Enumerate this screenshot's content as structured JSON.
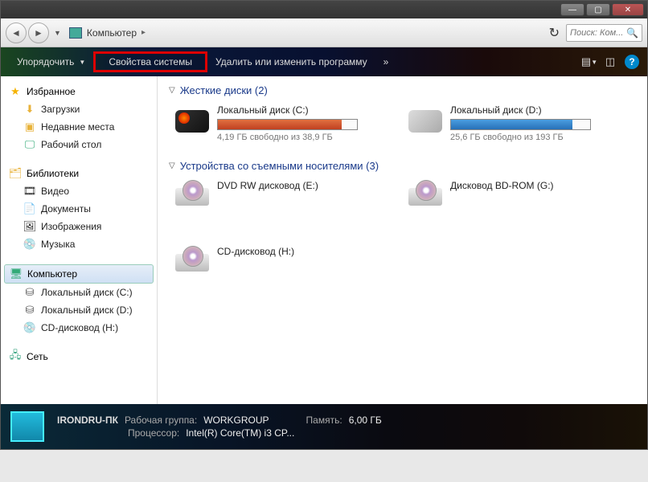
{
  "titlebar": {
    "min": "—",
    "max": "▢",
    "close": "✕"
  },
  "nav": {
    "location": "Компьютер",
    "search_placeholder": "Поиск: Ком..."
  },
  "toolbar": {
    "organize": "Упорядочить",
    "system_props": "Свойства системы",
    "uninstall": "Удалить или изменить программу",
    "overflow": "»"
  },
  "sidebar": {
    "favorites": {
      "label": "Избранное",
      "items": [
        {
          "icon": "download-icon",
          "label": "Загрузки"
        },
        {
          "icon": "recent-icon",
          "label": "Недавние места"
        },
        {
          "icon": "desktop-icon",
          "label": "Рабочий стол"
        }
      ]
    },
    "libraries": {
      "label": "Библиотеки",
      "items": [
        {
          "icon": "video-icon",
          "label": "Видео"
        },
        {
          "icon": "documents-icon",
          "label": "Документы"
        },
        {
          "icon": "pictures-icon",
          "label": "Изображения"
        },
        {
          "icon": "music-icon",
          "label": "Музыка"
        }
      ]
    },
    "computer": {
      "label": "Компьютер",
      "items": [
        {
          "icon": "disk-icon",
          "label": "Локальный диск (C:)"
        },
        {
          "icon": "disk-icon",
          "label": "Локальный диск (D:)"
        },
        {
          "icon": "cd-icon",
          "label": "CD-дисковод (H:)"
        }
      ]
    },
    "network": {
      "label": "Сеть"
    }
  },
  "content": {
    "hdd_section": "Жесткие диски (2)",
    "removable_section": "Устройства со съемными носителями (3)",
    "drives": [
      {
        "name": "Локальный диск (C:)",
        "free_text": "4,19 ГБ свободно из 38,9 ГБ",
        "fill_pct": 89,
        "warn": true
      },
      {
        "name": "Локальный диск (D:)",
        "free_text": "25,6 ГБ свободно из 193 ГБ",
        "fill_pct": 87,
        "warn": false
      }
    ],
    "removable": [
      {
        "name": "DVD RW дисковод (E:)"
      },
      {
        "name": "Дисковод BD-ROM (G:)"
      },
      {
        "name": "CD-дисковод (H:)"
      }
    ]
  },
  "status": {
    "name": "IRONDRU-ПК",
    "workgroup_label": "Рабочая группа:",
    "workgroup": "WORKGROUP",
    "cpu_label": "Процессор:",
    "cpu": "Intel(R) Core(TM) i3 CP...",
    "mem_label": "Память:",
    "mem": "6,00 ГБ"
  }
}
